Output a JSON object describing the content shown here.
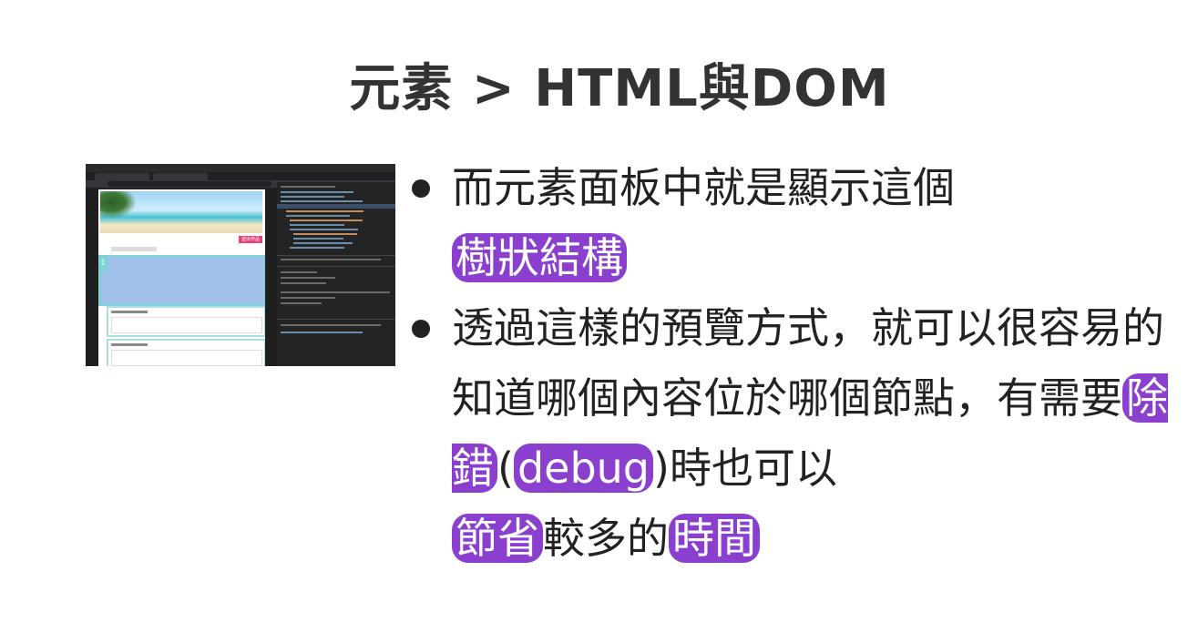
{
  "title": "元素 > HTML與DOM",
  "screenshot": {
    "alt_label": "Chrome DevTools Elements panel screenshot",
    "button_label": "送出作品",
    "badge": "1"
  },
  "bullets": [
    {
      "parts": [
        {
          "text": "而元素面板中就是顯示這個",
          "hl": false
        },
        {
          "text": "樹狀結構",
          "hl": true
        }
      ]
    },
    {
      "parts": [
        {
          "text": "透過這樣的預覽方式，就可以很容易的知道哪個內容位於哪個節點，有需要",
          "hl": false
        },
        {
          "text": "除錯",
          "hl": true
        },
        {
          "text": "(",
          "hl": false
        },
        {
          "text": "debug",
          "hl": true
        },
        {
          "text": ")時也可以",
          "hl": false
        },
        {
          "text": "節省",
          "hl": true
        },
        {
          "text": "較多的",
          "hl": false
        },
        {
          "text": "時間",
          "hl": true
        }
      ]
    }
  ],
  "colors": {
    "highlight": "#8a3fcf",
    "text": "#222222"
  }
}
